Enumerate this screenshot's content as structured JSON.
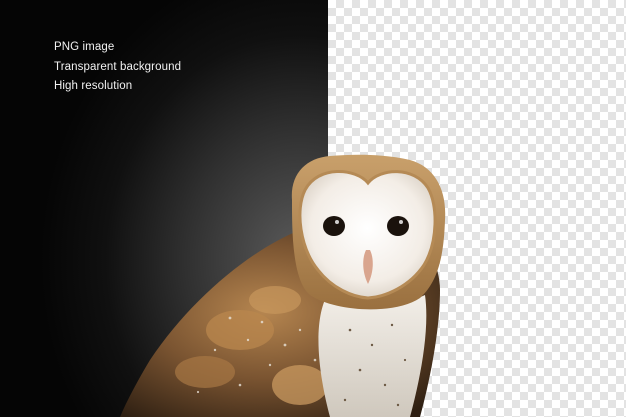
{
  "features": [
    "PNG image",
    "Transparent background",
    "High resolution"
  ],
  "subject": {
    "icon": "barn-owl-image"
  },
  "colors": {
    "dark_background": "#0c0c0c",
    "checker_light": "#ffffff",
    "checker_dark": "#e3e3e3",
    "text": "#f2f2f2"
  }
}
